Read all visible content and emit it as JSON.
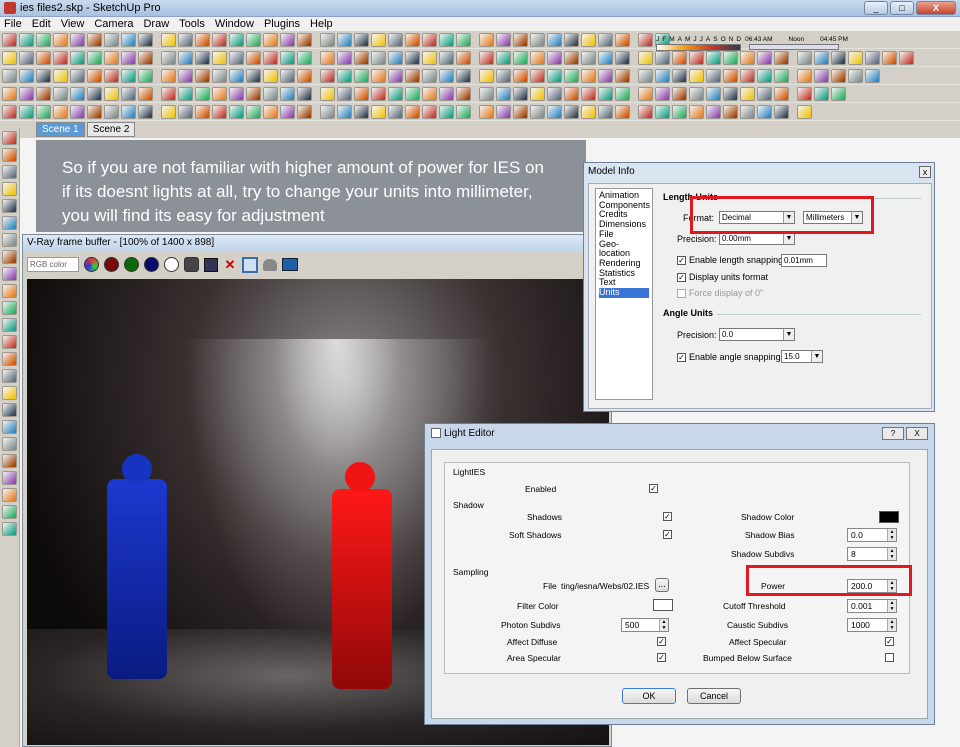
{
  "window": {
    "title": "ies files2.skp - SketchUp Pro",
    "btn_minimize": "_",
    "btn_maximize": "□",
    "btn_close": "X"
  },
  "menu": [
    "File",
    "Edit",
    "View",
    "Camera",
    "Draw",
    "Tools",
    "Window",
    "Plugins",
    "Help"
  ],
  "shadow_bar": {
    "months": [
      "J",
      "F",
      "M",
      "A",
      "M",
      "J",
      "J",
      "A",
      "S",
      "O",
      "N",
      "D"
    ],
    "time_start": "06:43 AM",
    "time_mid": "Noon",
    "time_end": "04:45 PM"
  },
  "scenes": [
    "Scene 1",
    "Scene 2"
  ],
  "overlay": {
    "line1": "So if you are not familiar with higher amount of power for IES on",
    "line2": "if its doesnt lights at all, try to change your units into millimeter,",
    "line3": "you will find its easy for adjustment"
  },
  "vray": {
    "title": "V-Ray frame buffer - [100% of 1400 x 898]",
    "color_mode": "RGB color"
  },
  "model_info": {
    "title": "Model Info",
    "close": "x",
    "categories": [
      "Animation",
      "Components",
      "Credits",
      "Dimensions",
      "File",
      "Geo-location",
      "Rendering",
      "Statistics",
      "Text",
      "Units"
    ],
    "selected_category": "Units",
    "length_units_title": "Length Units",
    "format_label": "Format:",
    "format_value": "Decimal",
    "unit_value": "Millimeters",
    "precision_label": "Precision:",
    "precision_value": "0.00mm",
    "length_snapping_label": "Enable length snapping",
    "length_snapping_value": "0.01mm",
    "display_units_label": "Display units format",
    "force_display_label": "Force display of 0\"",
    "angle_units_title": "Angle Units",
    "angle_precision_label": "Precision:",
    "angle_precision_value": "0.0",
    "angle_snapping_label": "Enable angle snapping",
    "angle_snapping_value": "15.0"
  },
  "light_editor": {
    "title": "Light Editor",
    "help_btn": "?",
    "close_btn": "X",
    "lightIES_label": "LightIES",
    "enabled_label": "Enabled",
    "shadow_group": "Shadow",
    "shadows_label": "Shadows",
    "soft_shadows_label": "Soft Shadows",
    "shadow_color_label": "Shadow Color",
    "shadow_bias_label": "Shadow Bias",
    "shadow_bias_value": "0.0",
    "shadow_subdivs_label": "Shadow Subdivs",
    "shadow_subdivs_value": "8",
    "sampling_group": "Sampling",
    "file_label": "File",
    "file_value": "ting/iesna/Webs/02.IES",
    "browse_btn": "...",
    "power_label": "Power",
    "power_value": "200.0",
    "filter_color_label": "Filter Color",
    "cutoff_label": "Cutoff Threshold",
    "cutoff_value": "0.001",
    "photon_label": "Photon Subdivs",
    "photon_value": "500",
    "caustic_label": "Caustic Subdivs",
    "caustic_value": "1000",
    "affect_diffuse_label": "Affect Diffuse",
    "affect_specular_label": "Affect Specular",
    "area_specular_label": "Area Specular",
    "bumped_below_label": "Bumped Below Surface",
    "ok_btn": "OK",
    "cancel_btn": "Cancel",
    "check_mark": "✓"
  },
  "colors": {
    "accent": "#3875d7",
    "highlight_box": "#e0191f",
    "blue_figure": "#1030c0",
    "red_figure": "#e01010"
  }
}
